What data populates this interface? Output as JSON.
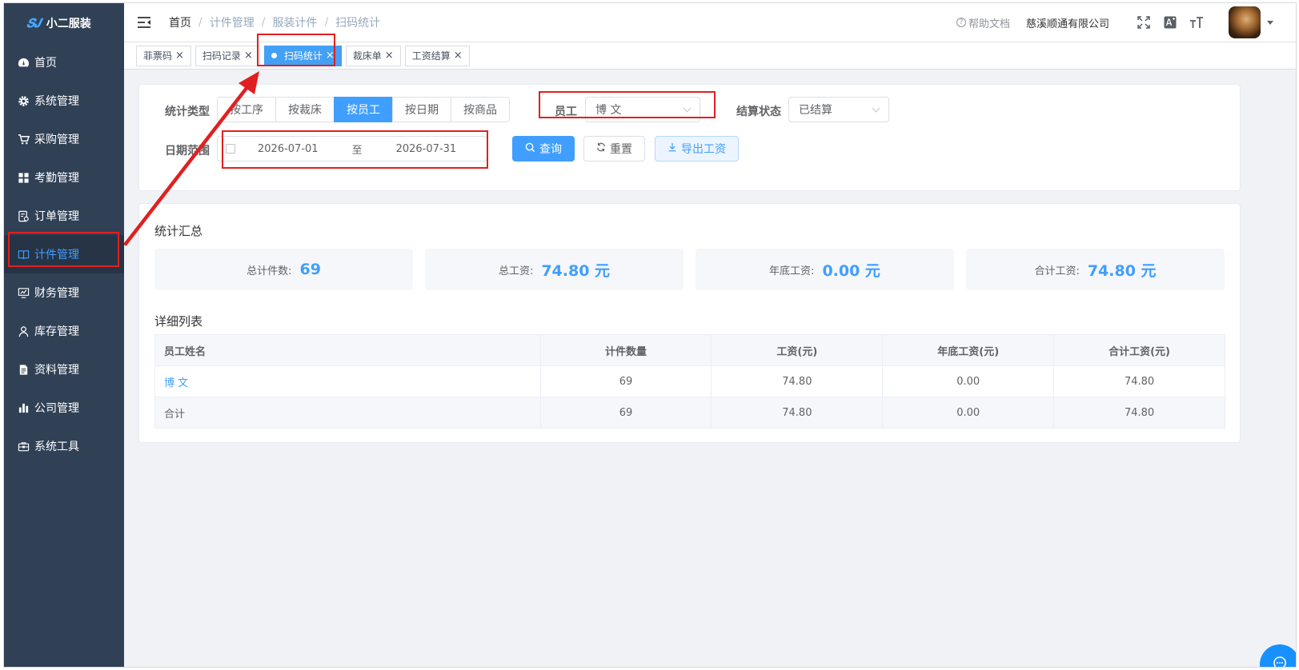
{
  "app": {
    "logo_mark": "𝑺𝑱",
    "title": "小二服装"
  },
  "sidebar": {
    "items": [
      {
        "label": "首页",
        "icon": "dashboard-icon"
      },
      {
        "label": "系统管理",
        "icon": "gear-icon"
      },
      {
        "label": "采购管理",
        "icon": "cart-icon"
      },
      {
        "label": "考勤管理",
        "icon": "grid-icon"
      },
      {
        "label": "订单管理",
        "icon": "order-icon"
      },
      {
        "label": "计件管理",
        "icon": "book-icon",
        "active": true
      },
      {
        "label": "财务管理",
        "icon": "monitor-icon"
      },
      {
        "label": "库存管理",
        "icon": "person-icon"
      },
      {
        "label": "资料管理",
        "icon": "document-icon"
      },
      {
        "label": "公司管理",
        "icon": "bar-chart-icon"
      },
      {
        "label": "系统工具",
        "icon": "toolbox-icon"
      }
    ]
  },
  "navbar": {
    "breadcrumb": [
      "首页",
      "计件管理",
      "服装计件",
      "扫码统计"
    ],
    "help": "帮助文档",
    "company": "慈溪顺通有限公司"
  },
  "tags": [
    {
      "label": "菲票码"
    },
    {
      "label": "扫码记录"
    },
    {
      "label": "扫码统计",
      "active": true
    },
    {
      "label": "裁床单"
    },
    {
      "label": "工资结算"
    }
  ],
  "filter": {
    "type_label": "统计类型",
    "types": [
      "按工序",
      "按裁床",
      "按员工",
      "按日期",
      "按商品"
    ],
    "active_type": "按员工",
    "employee_label": "员工",
    "employee_value": "博 文",
    "status_label": "结算状态",
    "status_value": "已结算",
    "date_label": "日期范围",
    "date_start": "2026-07-01",
    "date_sep": "至",
    "date_end": "2026-07-31",
    "query_btn": "查询",
    "reset_btn": "重置",
    "export_btn": "导出工资"
  },
  "summary": {
    "title": "统计汇总",
    "stats": [
      {
        "label": "总计件数:",
        "value": "69"
      },
      {
        "label": "总工资:",
        "value": "74.80 元"
      },
      {
        "label": "年底工资:",
        "value": "0.00 元"
      },
      {
        "label": "合计工资:",
        "value": "74.80 元"
      }
    ]
  },
  "detail": {
    "title": "详细列表",
    "columns": [
      "员工姓名",
      "计件数量",
      "工资(元)",
      "年底工资(元)",
      "合计工资(元)"
    ],
    "rows": [
      [
        "博 文",
        "69",
        "74.80",
        "0.00",
        "74.80"
      ]
    ],
    "total": [
      "合计",
      "69",
      "74.80",
      "0.00",
      "74.80"
    ]
  },
  "colors": {
    "primary": "#409eff",
    "sidebar": "#304156",
    "annotation": "#e02020"
  }
}
